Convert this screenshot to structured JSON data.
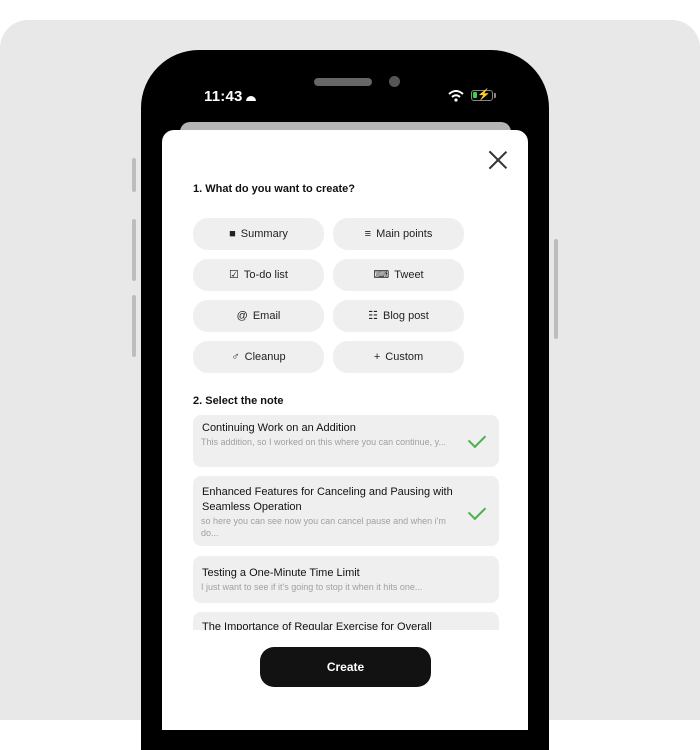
{
  "status_bar": {
    "time": "11:43",
    "icons": [
      "cloud-icon",
      "wifi-icon",
      "battery-charging-icon"
    ]
  },
  "dialog": {
    "close_icon": "close-icon",
    "section1_title": "1. What do you want to create?",
    "options": [
      {
        "label": "Summary",
        "icon": "bookmark-sparkle-icon",
        "glyph": "■"
      },
      {
        "label": "Main points",
        "icon": "list-icon",
        "glyph": "≡"
      },
      {
        "label": "To-do list",
        "icon": "checklist-icon",
        "glyph": "☑"
      },
      {
        "label": "Tweet",
        "icon": "keyboard-icon",
        "glyph": "⌨"
      },
      {
        "label": "Email",
        "icon": "at-icon",
        "glyph": "@"
      },
      {
        "label": "Blog post",
        "icon": "post-add-icon",
        "glyph": "☷"
      },
      {
        "label": "Cleanup",
        "icon": "broom-icon",
        "glyph": "♂"
      },
      {
        "label": "Custom",
        "icon": "plus-icon",
        "glyph": "+"
      }
    ],
    "section2_title": "2. Select the note",
    "notes": [
      {
        "title": "Continuing Work on an Addition",
        "preview": "This addition, so I worked on this where you can continue, y...",
        "selected": true
      },
      {
        "title": "Enhanced Features for Canceling and Pausing with Seamless Operation",
        "preview": "so here you can see now you can cancel pause and when i'm do...",
        "selected": true
      },
      {
        "title": "Testing a One-Minute Time Limit",
        "preview": "I just want to see if it's going to stop it when it hits one...",
        "selected": false
      },
      {
        "title": "The Importance of Regular Exercise for Overall",
        "preview": "",
        "selected": false
      }
    ],
    "create_label": "Create"
  },
  "colors": {
    "check": "#4caf50",
    "create_button": "#121212",
    "option_bg": "#efefef",
    "backdrop": "#e8e8e8"
  }
}
